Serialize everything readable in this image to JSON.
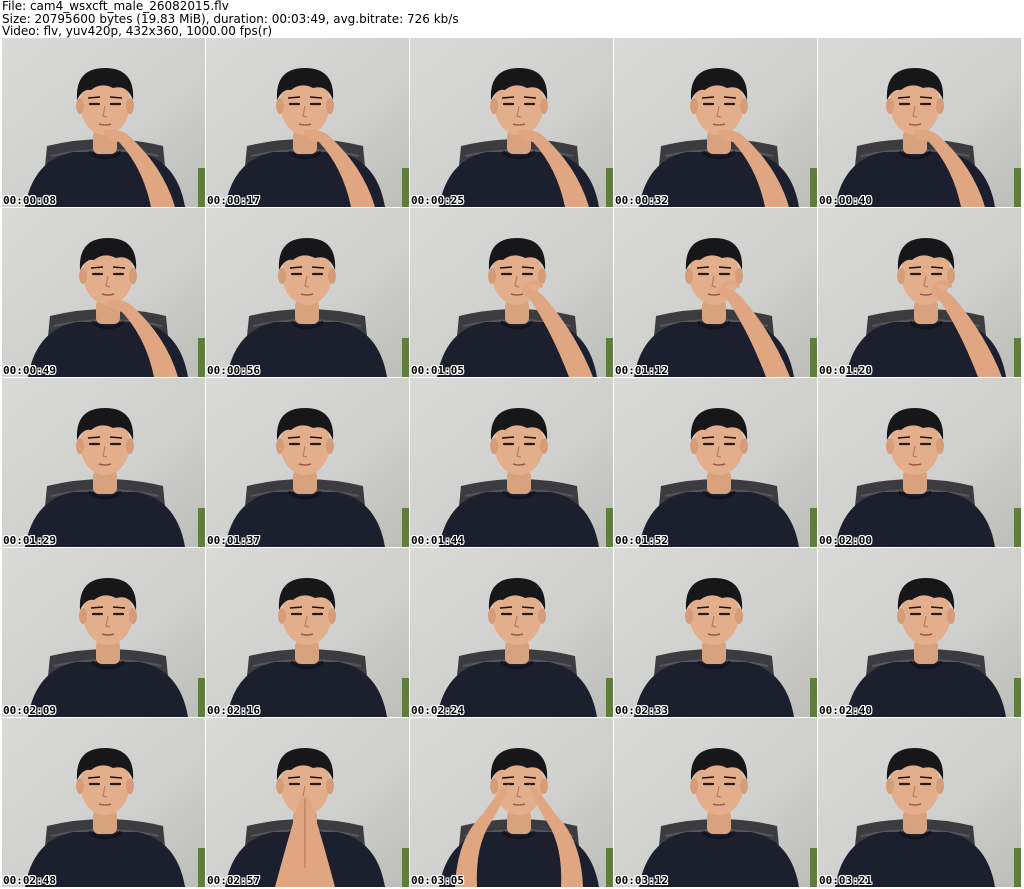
{
  "header": {
    "file_line": "File: cam4_wsxcft_male_26082015.flv",
    "size_line": "Size: 20795600 bytes (19.83 MiB), duration: 00:03:49, avg.bitrate: 726 kb/s",
    "video_line": "Video: flv, yuv420p, 432x360, 1000.00 fps(r)"
  },
  "thumbnails": [
    {
      "timestamp": "00:00:08",
      "pose": "hand-mouth"
    },
    {
      "timestamp": "00:00:17",
      "pose": "hand-mouth"
    },
    {
      "timestamp": "00:00:25",
      "pose": "hand-mouth"
    },
    {
      "timestamp": "00:00:32",
      "pose": "hand-mouth"
    },
    {
      "timestamp": "00:00:40",
      "pose": "hand-mouth"
    },
    {
      "timestamp": "00:00:49",
      "pose": "hand-mouth"
    },
    {
      "timestamp": "00:00:56",
      "pose": "neutral"
    },
    {
      "timestamp": "00:01:05",
      "pose": "hand-nose"
    },
    {
      "timestamp": "00:01:12",
      "pose": "hand-nose"
    },
    {
      "timestamp": "00:01:20",
      "pose": "hand-nose"
    },
    {
      "timestamp": "00:01:29",
      "pose": "neutral"
    },
    {
      "timestamp": "00:01:37",
      "pose": "neutral"
    },
    {
      "timestamp": "00:01:44",
      "pose": "neutral"
    },
    {
      "timestamp": "00:01:52",
      "pose": "neutral"
    },
    {
      "timestamp": "00:02:00",
      "pose": "neutral"
    },
    {
      "timestamp": "00:02:09",
      "pose": "neutral"
    },
    {
      "timestamp": "00:02:16",
      "pose": "neutral"
    },
    {
      "timestamp": "00:02:24",
      "pose": "neutral"
    },
    {
      "timestamp": "00:02:33",
      "pose": "neutral"
    },
    {
      "timestamp": "00:02:40",
      "pose": "neutral"
    },
    {
      "timestamp": "00:02:48",
      "pose": "neutral"
    },
    {
      "timestamp": "00:02:57",
      "pose": "hands-praying"
    },
    {
      "timestamp": "00:03:05",
      "pose": "hands-eyes"
    },
    {
      "timestamp": "00:03:12",
      "pose": "neutral"
    },
    {
      "timestamp": "00:03:21",
      "pose": "neutral"
    }
  ]
}
